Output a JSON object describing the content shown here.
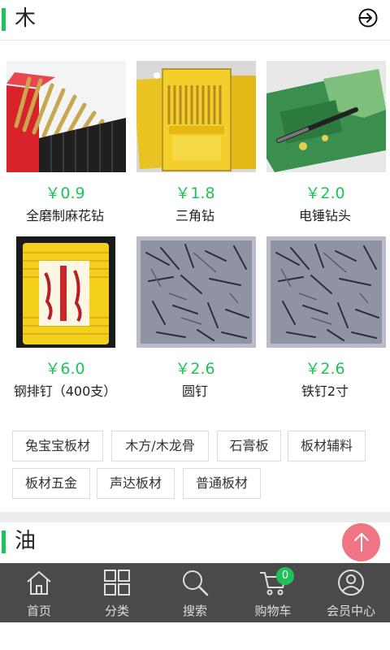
{
  "section1": {
    "title": "木",
    "products": [
      {
        "price": "￥0.9",
        "name": "全磨制麻花钻"
      },
      {
        "price": "￥1.8",
        "name": "三角钻"
      },
      {
        "price": "￥2.0",
        "name": "电锤钻头"
      },
      {
        "price": "￥6.0",
        "name": "钢排钉（400支）"
      },
      {
        "price": "￥2.6",
        "name": "圆钉"
      },
      {
        "price": "￥2.6",
        "name": "铁钉2寸"
      }
    ],
    "tags": [
      "兔宝宝板材",
      "木方/木龙骨",
      "石膏板",
      "板材辅料",
      "板材五金",
      "声达板材",
      "普通板材"
    ]
  },
  "section2": {
    "title": "油"
  },
  "tabbar": {
    "items": [
      {
        "label": "首页",
        "icon": "home-icon"
      },
      {
        "label": "分类",
        "icon": "category-grid-icon"
      },
      {
        "label": "搜索",
        "icon": "search-icon"
      },
      {
        "label": "购物车",
        "icon": "cart-icon"
      },
      {
        "label": "会员中心",
        "icon": "user-icon"
      }
    ],
    "cart_count": "0"
  },
  "colors": {
    "accent": "#20c15a",
    "tabbar_bg": "#4a4a4a",
    "float_btn": "#ef6b7b"
  }
}
